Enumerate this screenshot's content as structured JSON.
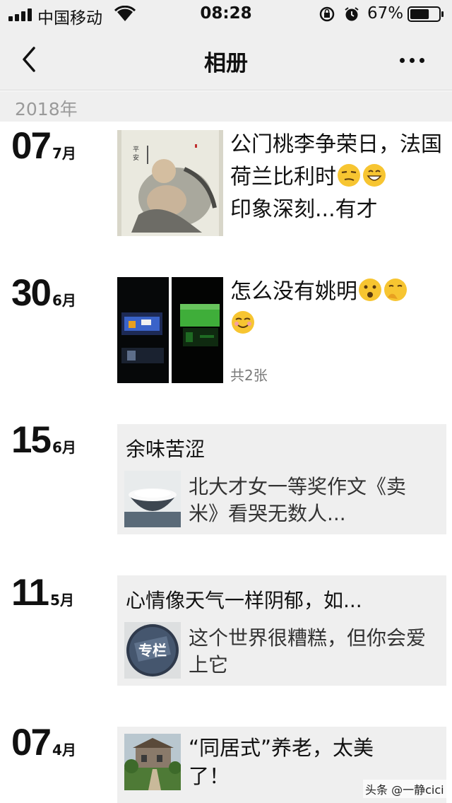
{
  "status_bar": {
    "carrier": "中国移动",
    "time": "08:28",
    "battery_percent": "67%",
    "battery_level": 0.67,
    "icons": [
      "signal-icon",
      "wifi-icon",
      "orientation-lock-icon",
      "alarm-icon",
      "battery-icon"
    ]
  },
  "nav": {
    "title": "相册",
    "back_icon": "chevron-left-icon",
    "more_icon": "more-dots-icon"
  },
  "year": "2018年",
  "entries": [
    {
      "day": "07",
      "month": "7月",
      "text": "公门桃李争荣日，法国荷兰比利时",
      "emojis": [
        "smirk-emoji",
        "grin-emoji"
      ],
      "continuation": "印象深刻...有才"
    },
    {
      "day": "30",
      "month": "6月",
      "text": "怎么没有姚明",
      "emojis": [
        "thinking-emoji",
        "shush-emoji",
        "smug-emoji"
      ],
      "count": "共2张"
    },
    {
      "day": "15",
      "month": "6月",
      "card_title": "余味苦涩",
      "card_desc": "北大才女一等奖作文《卖米》看哭无数人..."
    },
    {
      "day": "11",
      "month": "5月",
      "card_title": "心情像天气一样阴郁，如...",
      "card_thumb_text": "专栏",
      "card_desc": "这个世界很糟糕，但你会爱上它"
    },
    {
      "day": "07",
      "month": "4月",
      "card_desc": "“同居式”养老，太美了！"
    }
  ],
  "watermark": "头条 @一静cici",
  "colors": {
    "header_bg": "#efefef",
    "card_bg": "#efefef",
    "muted_text": "#9a9a9a",
    "emoji_yellow": "#f7c531"
  }
}
